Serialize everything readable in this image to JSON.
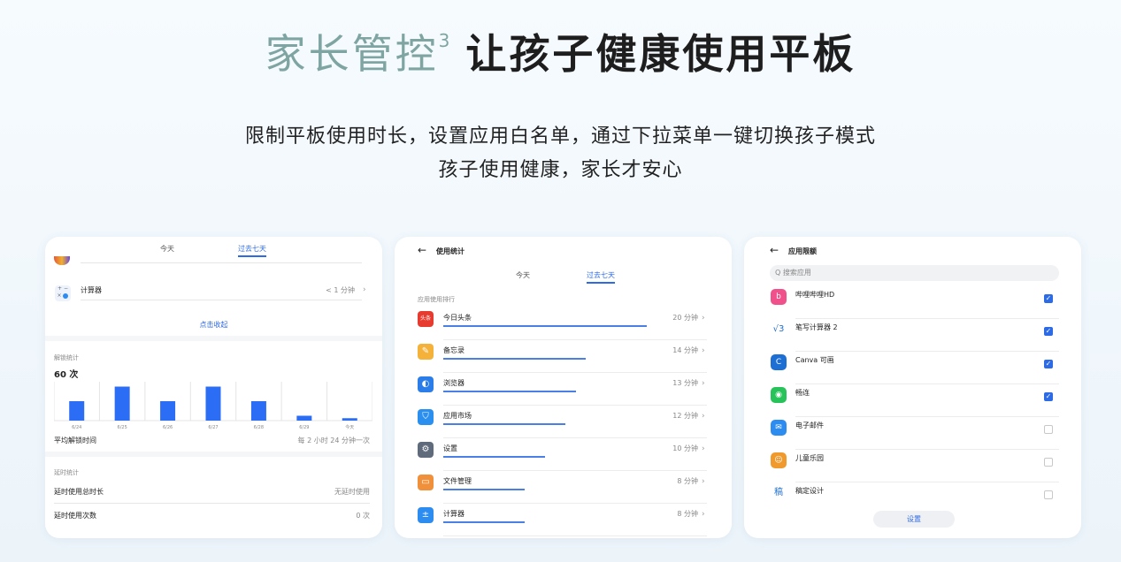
{
  "headline": {
    "accent": "家长管控",
    "sup": "3",
    "rest": "让孩子健康使用平板"
  },
  "subtitle": {
    "line1": "限制平板使用时长，设置应用白名单，通过下拉菜单一键切换孩子模式",
    "line2": "孩子使用健康，家长才安心"
  },
  "panel1": {
    "tabs": [
      "今天",
      "过去七天"
    ],
    "calc_row": {
      "name": "计算器",
      "time": "< 1 分钟"
    },
    "collapse": "点击收起",
    "unlock": {
      "title": "解锁统计",
      "count": "60 次",
      "chart_labels": [
        "6/24",
        "6/25",
        "6/26",
        "6/27",
        "6/28",
        "6/29",
        "今天"
      ],
      "avg_label": "平均解锁时间",
      "avg_value": "每 2 小时 24 分钟一次"
    },
    "extend": {
      "title": "延时统计",
      "total_label": "延时使用总时长",
      "total_value": "无延时使用",
      "count_label": "延时使用次数",
      "count_value": "0 次"
    }
  },
  "chart_data": {
    "type": "bar",
    "categories": [
      "6/24",
      "6/25",
      "6/26",
      "6/27",
      "6/28",
      "6/29",
      "今天"
    ],
    "values": [
      8,
      14,
      8,
      14,
      8,
      2,
      1
    ],
    "title": "解锁统计"
  },
  "panel2": {
    "title": "使用统计",
    "tabs": [
      "今天",
      "过去七天"
    ],
    "section": "应用使用排行",
    "rows": [
      {
        "name": "今日头条",
        "time": "20 分钟",
        "fill": 1.0,
        "icon": "toutiao-icon",
        "color": "#e63b2e"
      },
      {
        "name": "备忘录",
        "time": "14 分钟",
        "fill": 0.7,
        "icon": "memo-icon",
        "color": "#f4b23a"
      },
      {
        "name": "浏览器",
        "time": "13 分钟",
        "fill": 0.65,
        "icon": "browser-icon",
        "color": "#2b7de9"
      },
      {
        "name": "应用市场",
        "time": "12 分钟",
        "fill": 0.6,
        "icon": "appmarket-icon",
        "color": "#2b8ff0"
      },
      {
        "name": "设置",
        "time": "10 分钟",
        "fill": 0.5,
        "icon": "settings-icon",
        "color": "#5f6b7a"
      },
      {
        "name": "文件管理",
        "time": "8 分钟",
        "fill": 0.4,
        "icon": "files-icon",
        "color": "#f1903a"
      },
      {
        "name": "计算器",
        "time": "8 分钟",
        "fill": 0.4,
        "icon": "calculator-icon",
        "color": "#2d8cf0"
      }
    ]
  },
  "panel3": {
    "title": "应用限额",
    "search_placeholder": "Q 搜索应用",
    "apps": [
      {
        "name": "哔哩哔哩HD",
        "checked": true,
        "icon": "bilibili-icon",
        "color": "#f1518a"
      },
      {
        "name": "笔写计算器 2",
        "checked": true,
        "icon": "calc2-icon",
        "color": "#ffffff"
      },
      {
        "name": "Canva 可画",
        "checked": true,
        "icon": "canva-icon",
        "color": "#1e6fd4"
      },
      {
        "name": "畅连",
        "checked": true,
        "icon": "changlian-icon",
        "color": "#27c35a"
      },
      {
        "name": "电子邮件",
        "checked": false,
        "icon": "email-icon",
        "color": "#2d8cf0"
      },
      {
        "name": "儿童乐园",
        "checked": false,
        "icon": "kids-icon",
        "color": "#f09a2d"
      },
      {
        "name": "稿定设计",
        "checked": false,
        "icon": "gaoding-icon",
        "color": "#ffffff"
      }
    ],
    "button": "设置"
  }
}
